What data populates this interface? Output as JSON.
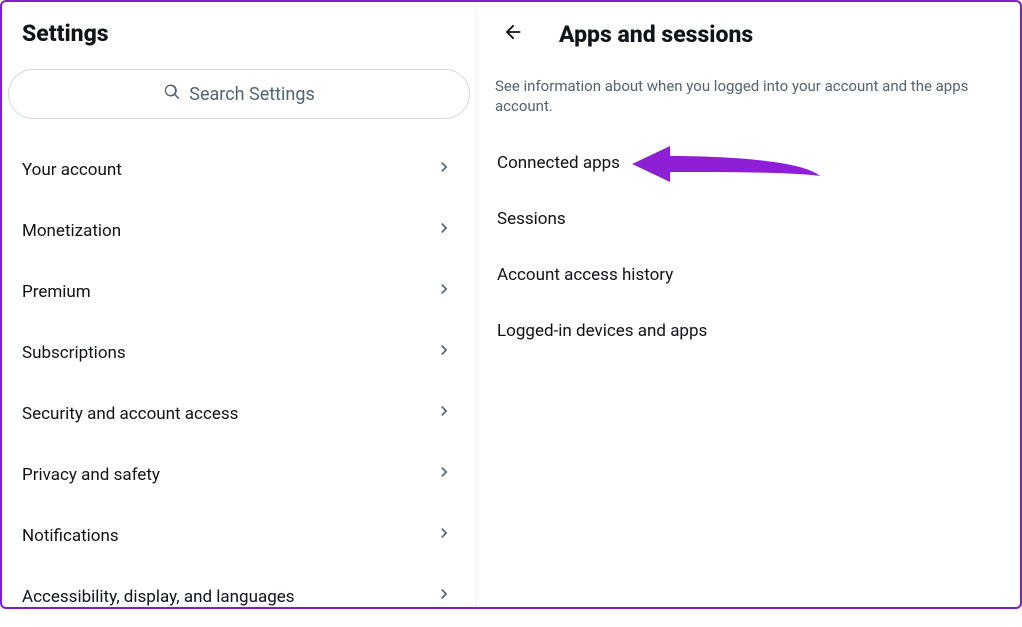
{
  "left": {
    "title": "Settings",
    "search_placeholder": "Search Settings",
    "nav": [
      "Your account",
      "Monetization",
      "Premium",
      "Subscriptions",
      "Security and account access",
      "Privacy and safety",
      "Notifications",
      "Accessibility, display, and languages"
    ]
  },
  "right": {
    "title": "Apps and sessions",
    "description": "See information about when you logged into your account and the apps account.",
    "items": [
      "Connected apps",
      "Sessions",
      "Account access history",
      "Logged-in devices and apps"
    ]
  }
}
